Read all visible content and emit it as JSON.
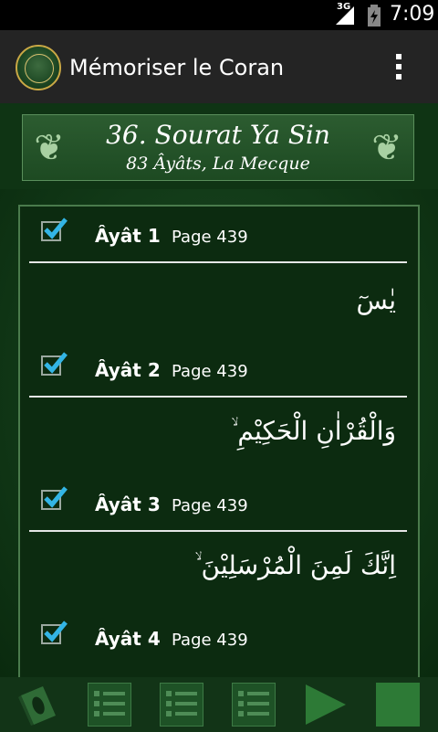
{
  "status_bar": {
    "network": "3G",
    "time": "7:09"
  },
  "app": {
    "title": "Mémoriser le Coran"
  },
  "surah": {
    "title": "36. Sourat Ya Sin",
    "subtitle": "83 Âyâts, La Mecque"
  },
  "ayahs": [
    {
      "label": "Âyât 1",
      "page": "Page 439",
      "arabic": "يٰسٓ",
      "checked": true
    },
    {
      "label": "Âyât 2",
      "page": "Page 439",
      "arabic": "وَالْقُرْاٰنِ الْحَكِيْمِ ۙ",
      "checked": true
    },
    {
      "label": "Âyât 3",
      "page": "Page 439",
      "arabic": "اِنَّكَ لَمِنَ الْمُرْسَلِيْنَ ۙ",
      "checked": true
    },
    {
      "label": "Âyât 4",
      "page": "Page 439",
      "arabic": "",
      "checked": true
    }
  ],
  "colors": {
    "accent_check": "#33b5e5",
    "background_green": "#123a18",
    "action_bar": "#242424"
  },
  "bottom_toolbar": [
    "quran-book-icon",
    "list-icon",
    "list-icon",
    "list-icon",
    "play-icon",
    "stop-icon"
  ]
}
